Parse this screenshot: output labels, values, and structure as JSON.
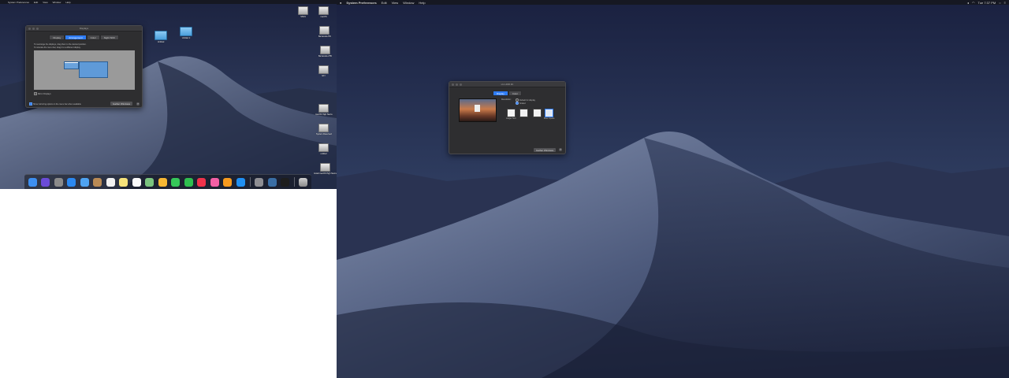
{
  "left_screen": {
    "menubar": {
      "items": [
        "System Preferences",
        "Edit",
        "View",
        "Window",
        "Help"
      ]
    },
    "window": {
      "title": "Displays",
      "tabs": [
        {
          "label": "Display",
          "active": false
        },
        {
          "label": "Arrangement",
          "active": true
        },
        {
          "label": "Color",
          "active": false
        },
        {
          "label": "Night Shift",
          "active": false
        }
      ],
      "instruction_1": "To rearrange the displays, drag them to the desired position.",
      "instruction_2": "To relocate the menu bar, drag it to a different display.",
      "mirror_label": "Mirror Displays",
      "show_mirroring_label": "Show mirroring options in the menu bar when available",
      "gather_button": "Gather Windows",
      "help": "?"
    },
    "desktop_folders": [
      {
        "label": "Untitled",
        "icon": "folder-icon"
      },
      {
        "label": "Untitled 2",
        "icon": "folder-icon"
      }
    ],
    "desktop_drives": [
      {
        "label": "SSD1",
        "icon": "drive-icon"
      },
      {
        "label": "macOS",
        "icon": "drive-icon"
      },
      {
        "label": "Barracuda HD",
        "icon": "drive-icon"
      },
      {
        "label": "Barracuda 2TB",
        "icon": "drive-icon"
      },
      {
        "label": "EFI",
        "icon": "drive-icon"
      },
      {
        "label": "macOS High Sierra",
        "icon": "drive-icon"
      },
      {
        "label": "System Reserved",
        "icon": "drive-icon"
      },
      {
        "label": "untitled",
        "icon": "drive-icon"
      },
      {
        "label": "Install macOS High Sierra",
        "icon": "drive-icon"
      }
    ],
    "dock": {
      "apps": [
        {
          "name": "Finder",
          "color": "#3d8ff0"
        },
        {
          "name": "Siri",
          "color": "#6a4bd8"
        },
        {
          "name": "Launchpad",
          "color": "#8a8a8a"
        },
        {
          "name": "Safari",
          "color": "#2b88f0"
        },
        {
          "name": "Mail",
          "color": "#4ea3f2"
        },
        {
          "name": "Contacts",
          "color": "#b98a55"
        },
        {
          "name": "Calendar",
          "color": "#f2f2f2"
        },
        {
          "name": "Notes",
          "color": "#f6e27a"
        },
        {
          "name": "Reminders",
          "color": "#fafafa"
        },
        {
          "name": "Maps",
          "color": "#7bc47f"
        },
        {
          "name": "Photos",
          "color": "#f7b733"
        },
        {
          "name": "Messages",
          "color": "#35c759"
        },
        {
          "name": "FaceTime",
          "color": "#2fbf4f"
        },
        {
          "name": "News",
          "color": "#f0324b"
        },
        {
          "name": "iTunes",
          "color": "#f35fa5"
        },
        {
          "name": "iBooks",
          "color": "#f79a1e"
        },
        {
          "name": "App Store",
          "color": "#1f8ff2"
        },
        {
          "name": "System Preferences",
          "color": "#8e8e93"
        },
        {
          "name": "Activity Monitor",
          "color": "#3a6ea5"
        },
        {
          "name": "Terminal",
          "color": "#1e1e1e"
        }
      ],
      "trash_label": "Trash"
    }
  },
  "right_screen": {
    "menubar": {
      "items": [
        "System Preferences",
        "Edit",
        "View",
        "Window",
        "Help"
      ],
      "clock": "Tue 7:37 PM"
    },
    "window": {
      "title": "LG HDR 4K",
      "tabs": [
        {
          "label": "Display",
          "active": true
        },
        {
          "label": "Color",
          "active": false
        }
      ],
      "resolution_label": "Resolution:",
      "option_default": "Default for display",
      "option_scaled": "Scaled",
      "scale_options": [
        {
          "label": "Larger Text"
        },
        {
          "label": ""
        },
        {
          "label": ""
        },
        {
          "label": "More Space"
        }
      ],
      "gather_button": "Gather Windows",
      "help": "?"
    }
  }
}
